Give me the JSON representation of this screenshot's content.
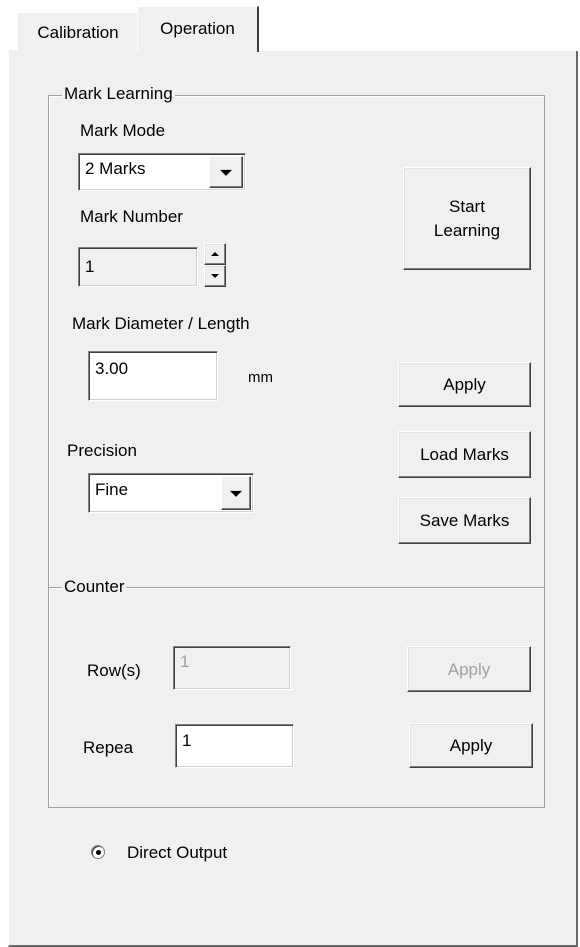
{
  "tabs": [
    {
      "label": "Calibration",
      "active": false
    },
    {
      "label": "Operation",
      "active": true
    }
  ],
  "mark_learning": {
    "title": "Mark Learning",
    "mark_mode_label": "Mark Mode",
    "mark_mode_value": "2 Marks",
    "mark_number_label": "Mark Number",
    "mark_number_value": "1",
    "start_learning_label": "Start\nLearning",
    "diameter_label": "Mark Diameter / Length",
    "diameter_value": "3.00",
    "diameter_unit": "mm",
    "apply_label": "Apply",
    "precision_label": "Precision",
    "precision_value": "Fine",
    "load_marks_label": "Load Marks",
    "save_marks_label": "Save Marks"
  },
  "counter": {
    "title": "Counter",
    "rows_label": "Row(s)",
    "rows_value": "1",
    "rows_apply_label": "Apply",
    "repeat_label": "Repea",
    "repeat_value": "1",
    "repeat_apply_label": "Apply"
  },
  "output": {
    "direct_output_label": "Direct Output",
    "direct_output_selected": true
  },
  "colors": {
    "face": "#f0f0f0",
    "border_dark": "#696969",
    "disabled_text": "#a0a0a0"
  }
}
